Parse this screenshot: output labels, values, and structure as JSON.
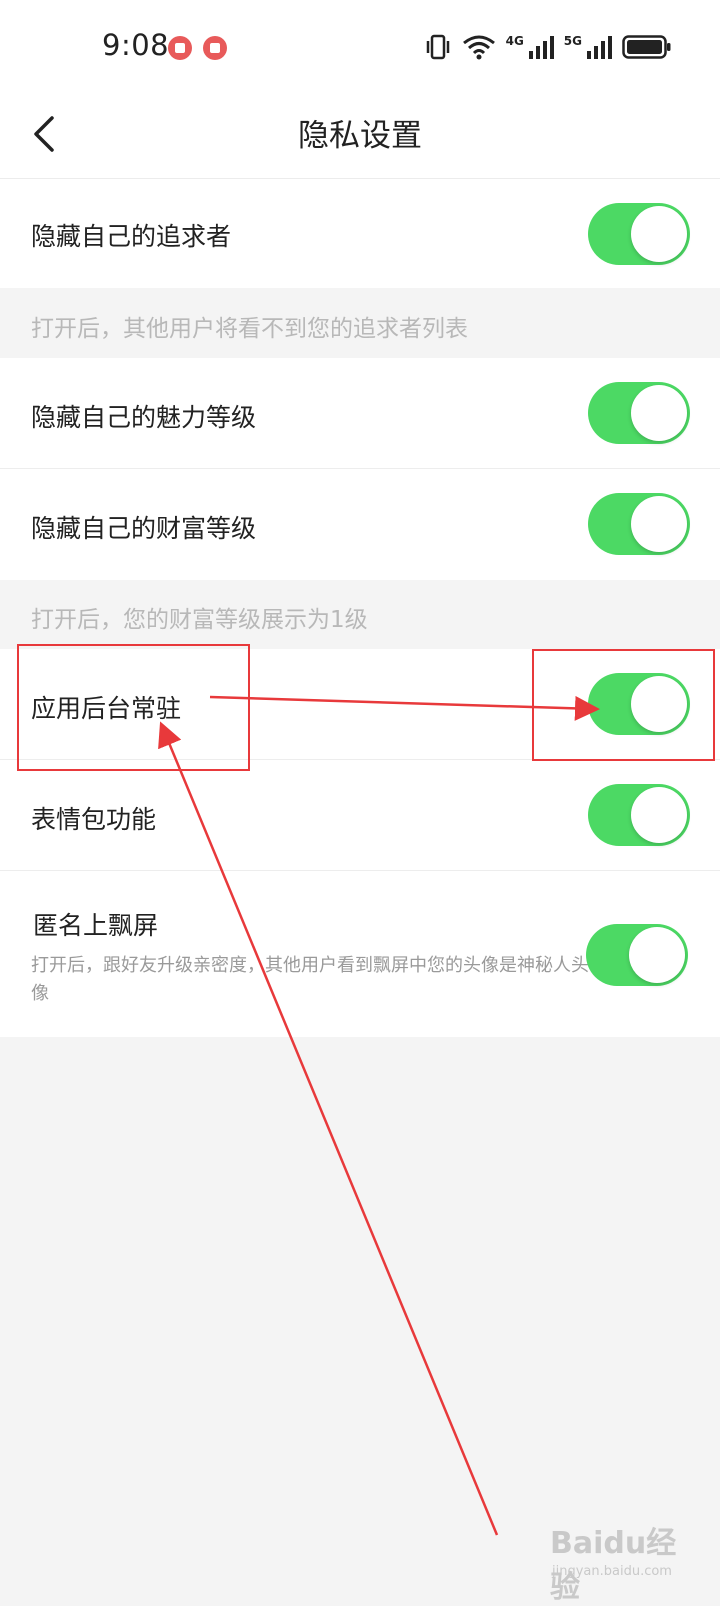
{
  "status_bar": {
    "time": "9:08",
    "network_labels": [
      "4G",
      "5G"
    ]
  },
  "header": {
    "title": "隐私设置",
    "back_icon": "chevron-left-icon"
  },
  "settings": [
    {
      "id": "hide-pursuers",
      "label": "隐藏自己的追求者",
      "on": true
    },
    {
      "id": "hide-charm-level",
      "label": "隐藏自己的魅力等级",
      "on": true
    },
    {
      "id": "hide-wealth-level",
      "label": "隐藏自己的财富等级",
      "on": true
    },
    {
      "id": "app-background-resident",
      "label": "应用后台常驻",
      "on": true
    },
    {
      "id": "sticker-feature",
      "label": "表情包功能",
      "on": true
    },
    {
      "id": "anonymous-screen-float",
      "label": "匿名上飘屏",
      "desc": "打开后，跟好友升级亲密度，其他用户看到飘屏中您的头像是神秘人头像",
      "on": true
    }
  ],
  "hints": {
    "pursuers": "打开后，其他用户将看不到您的追求者列表",
    "wealth": "打开后，您的财富等级展示为1级"
  },
  "watermark": {
    "main": "Baidu经验",
    "sub": "jingyan.baidu.com"
  },
  "colors": {
    "toggle_on": "#4cd964",
    "annotation": "#e8393b",
    "background": "#f4f4f4"
  }
}
